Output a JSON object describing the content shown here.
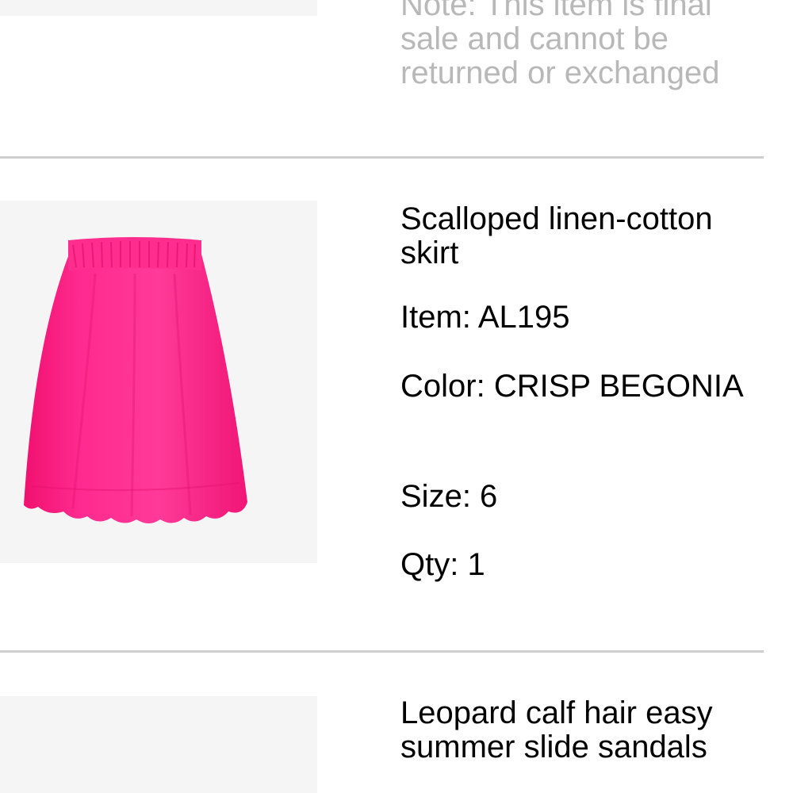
{
  "previous_item": {
    "note": "Note: This item is final sale and cannot be returned or exchanged"
  },
  "current_item": {
    "name": "Scalloped linen-cotton skirt",
    "item_label": "Item: AL195",
    "color_label": "Color: CRISP BEGONIA",
    "size_label": "Size: 6",
    "qty_label": "Qty: 1",
    "product_color": "#ff1f88"
  },
  "next_item": {
    "name": "Leopard calf hair easy summer slide sandals"
  }
}
